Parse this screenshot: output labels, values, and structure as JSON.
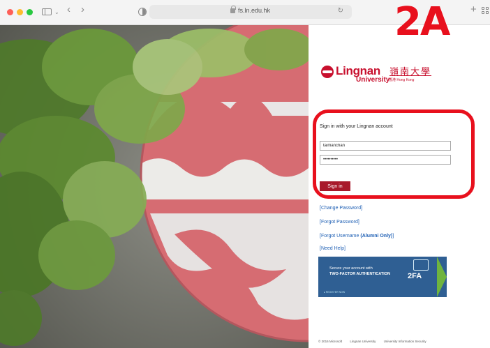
{
  "browser": {
    "url": "fs.ln.edu.hk",
    "icons": [
      "sidebar-icon",
      "chevron-down-icon",
      "back-icon",
      "forward-icon",
      "privacy-shield-icon",
      "lock-icon",
      "reload-icon",
      "new-tab-icon",
      "tab-overview-icon"
    ]
  },
  "annotation": {
    "badge": "2A",
    "color": "#e8101d"
  },
  "logo": {
    "word": "Lingnan",
    "chinese": "嶺南大學",
    "university": "University",
    "hk": "香港 Hong Kong"
  },
  "signin": {
    "title": "Sign in with your Lingnan account",
    "username_value": "taimanchan",
    "password_value": "••••••••••",
    "button_label": "Sign in",
    "button_color": "#a8192b"
  },
  "links": {
    "change_password": "[Change Password]",
    "forgot_password": "[Forgot Password]",
    "forgot_username_prefix": "[Forgot Username ",
    "forgot_username_bold": "(Alumni Only)",
    "forgot_username_suffix": "]",
    "need_help": "[Need Help]"
  },
  "tfa_banner": {
    "line1": "Secure your account with",
    "line2": "TWO-FACTOR AUTHENTICATION",
    "register": "▸ REGISTER NOW",
    "badge": "2FA"
  },
  "footer": {
    "copyright": "© 2016 Microsoft",
    "university": "Lingnan University",
    "security": "University Information Security"
  }
}
